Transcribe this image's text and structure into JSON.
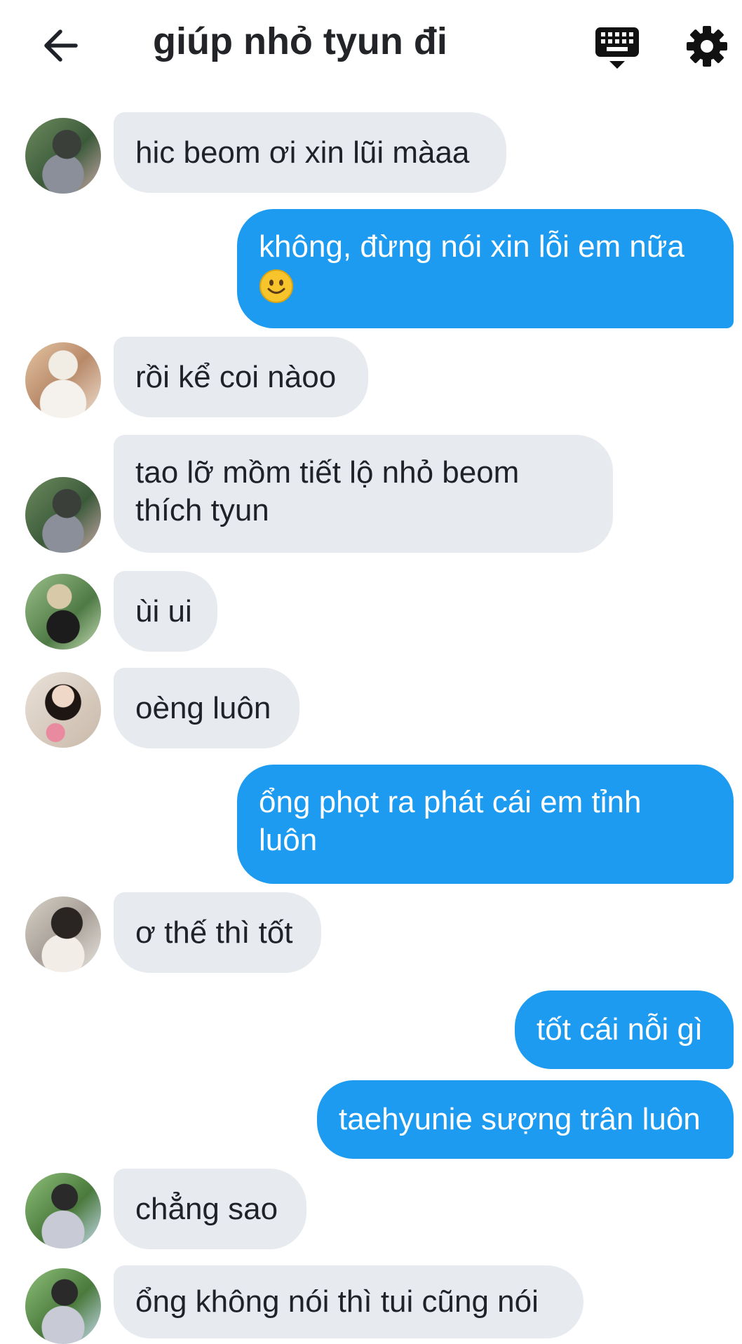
{
  "header": {
    "title": "giúp nhỏ tyun đi"
  },
  "icons": {
    "back": "arrow-left-icon",
    "keyboard": "keyboard-icon",
    "settings": "gear-icon",
    "smiley": "smiley-emoji-icon"
  },
  "colors": {
    "outgoing_bubble": "#1d9bf0",
    "incoming_bubble": "#e7eaee",
    "text": "#1f2329"
  },
  "messages": [
    {
      "side": "in",
      "text": "hic beom ơi xin lũi màaa"
    },
    {
      "side": "out",
      "text": "không, đừng nói xin lỗi em nữa",
      "emoji": "smiley"
    },
    {
      "side": "in",
      "text": "rồi kể coi nàoo"
    },
    {
      "side": "in",
      "lines": [
        "tao lỡ mồm tiết lộ nhỏ beom",
        "thích tyun"
      ]
    },
    {
      "side": "in",
      "text": "ùi ui"
    },
    {
      "side": "in",
      "text": "oèng luôn"
    },
    {
      "side": "out",
      "lines": [
        "ổng phọt ra phát cái em tỉnh",
        "luôn"
      ]
    },
    {
      "side": "in",
      "text": "ơ thế thì tốt"
    },
    {
      "side": "out",
      "text": "tốt cái nỗi gì"
    },
    {
      "side": "out",
      "text": "taehyunie sượng trân luôn"
    },
    {
      "side": "in",
      "text": "chẳng sao"
    },
    {
      "side": "in",
      "text": "ổng không nói thì tui cũng nói"
    }
  ]
}
